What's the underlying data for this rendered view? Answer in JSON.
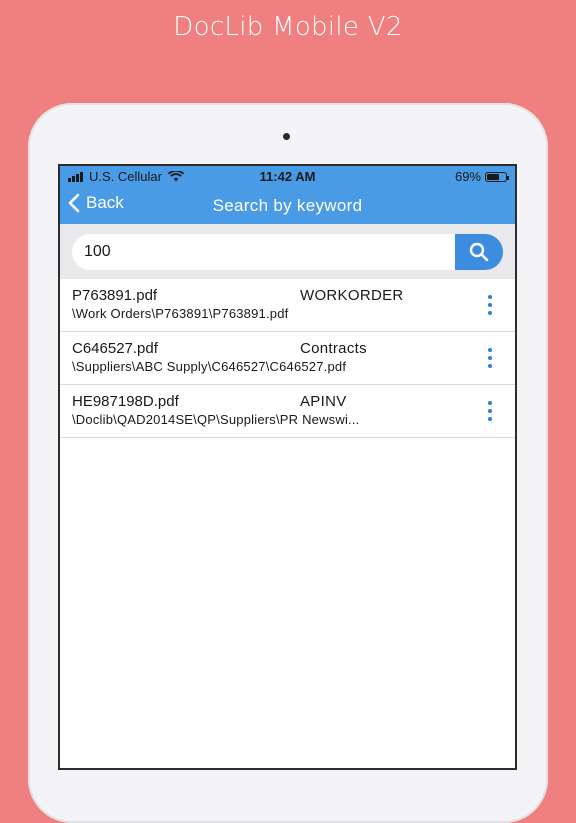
{
  "promo": {
    "title": "DocLib Mobile V2"
  },
  "status_bar": {
    "carrier": "U.S. Cellular",
    "time": "11:42 AM",
    "battery_percent": "69%",
    "battery_level": 0.69
  },
  "nav": {
    "back_label": "Back",
    "title": "Search by keyword"
  },
  "search": {
    "value": "100",
    "button_icon": "search-icon"
  },
  "colors": {
    "background": "#f07f80",
    "header": "#4a9be6",
    "accent": "#3c8de0"
  },
  "results": [
    {
      "name": "P763891.pdf",
      "type": "WORKORDER",
      "path": "\\Work Orders\\P763891\\P763891.pdf",
      "menu_icon": "more-vertical-icon"
    },
    {
      "name": "C646527.pdf",
      "type": "Contracts",
      "path": "\\Suppliers\\ABC Supply\\C646527\\C646527.pdf",
      "menu_icon": "more-vertical-icon"
    },
    {
      "name": "HE987198D.pdf",
      "type": "APINV",
      "path": "\\Doclib\\QAD2014SE\\QP\\Suppliers\\PR Newswi...",
      "menu_icon": "more-vertical-icon"
    }
  ]
}
